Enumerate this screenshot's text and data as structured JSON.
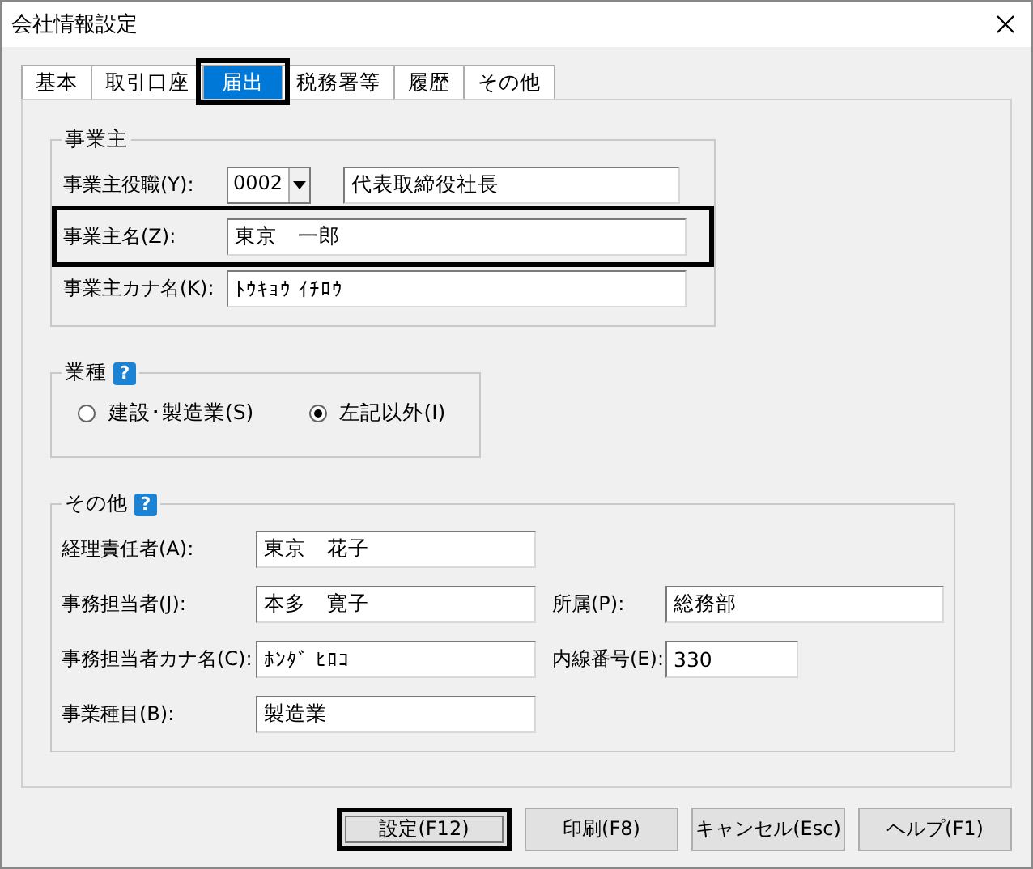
{
  "window": {
    "title": "会社情報設定"
  },
  "tabs": [
    {
      "label": "基本",
      "selected": false,
      "highlighted": false
    },
    {
      "label": "取引口座",
      "selected": false,
      "highlighted": false
    },
    {
      "label": "届出",
      "selected": true,
      "highlighted": true
    },
    {
      "label": "税務署等",
      "selected": false,
      "highlighted": false
    },
    {
      "label": "履歴",
      "selected": false,
      "highlighted": false
    },
    {
      "label": "その他",
      "selected": false,
      "highlighted": false
    }
  ],
  "owner": {
    "title": "事業主",
    "fields": [
      {
        "kind": "combo",
        "label": "事業主役職(Y):",
        "code": "0002",
        "value": "代表取締役社長",
        "highlighted": false
      },
      {
        "kind": "text",
        "label": "事業主名(Z):",
        "value": "東京　一郎",
        "highlighted": true
      },
      {
        "kind": "text",
        "label": "事業主カナ名(K):",
        "value": "ﾄｳｷｮｳ ｲﾁﾛｳ",
        "highlighted": false
      }
    ]
  },
  "industry": {
    "title": "業種",
    "help": "?",
    "options": [
      {
        "label": "建設･製造業(S)",
        "selected": false
      },
      {
        "label": "左記以外(I)",
        "selected": true
      }
    ]
  },
  "other": {
    "title": "その他",
    "help": "?",
    "rows": [
      [
        {
          "label": "経理責任者(A):",
          "value": "東京　花子"
        }
      ],
      [
        {
          "label": "事務担当者(J):",
          "value": "本多　寛子"
        },
        {
          "label": "所属(P):",
          "value": "総務部"
        }
      ],
      [
        {
          "label": "事務担当者カナ名(C):",
          "value": "ﾎﾝﾀﾞ ﾋﾛｺ"
        },
        {
          "label": "内線番号(E):",
          "value": "330"
        }
      ],
      [
        {
          "label": "事業種目(B):",
          "value": "製造業"
        }
      ]
    ]
  },
  "buttons": [
    {
      "label": "設定(F12)",
      "highlighted": true
    },
    {
      "label": "印刷(F8)",
      "highlighted": false
    },
    {
      "label": "キャンセル(Esc)",
      "highlighted": false
    },
    {
      "label": "ヘルプ(F1)",
      "highlighted": false
    }
  ]
}
